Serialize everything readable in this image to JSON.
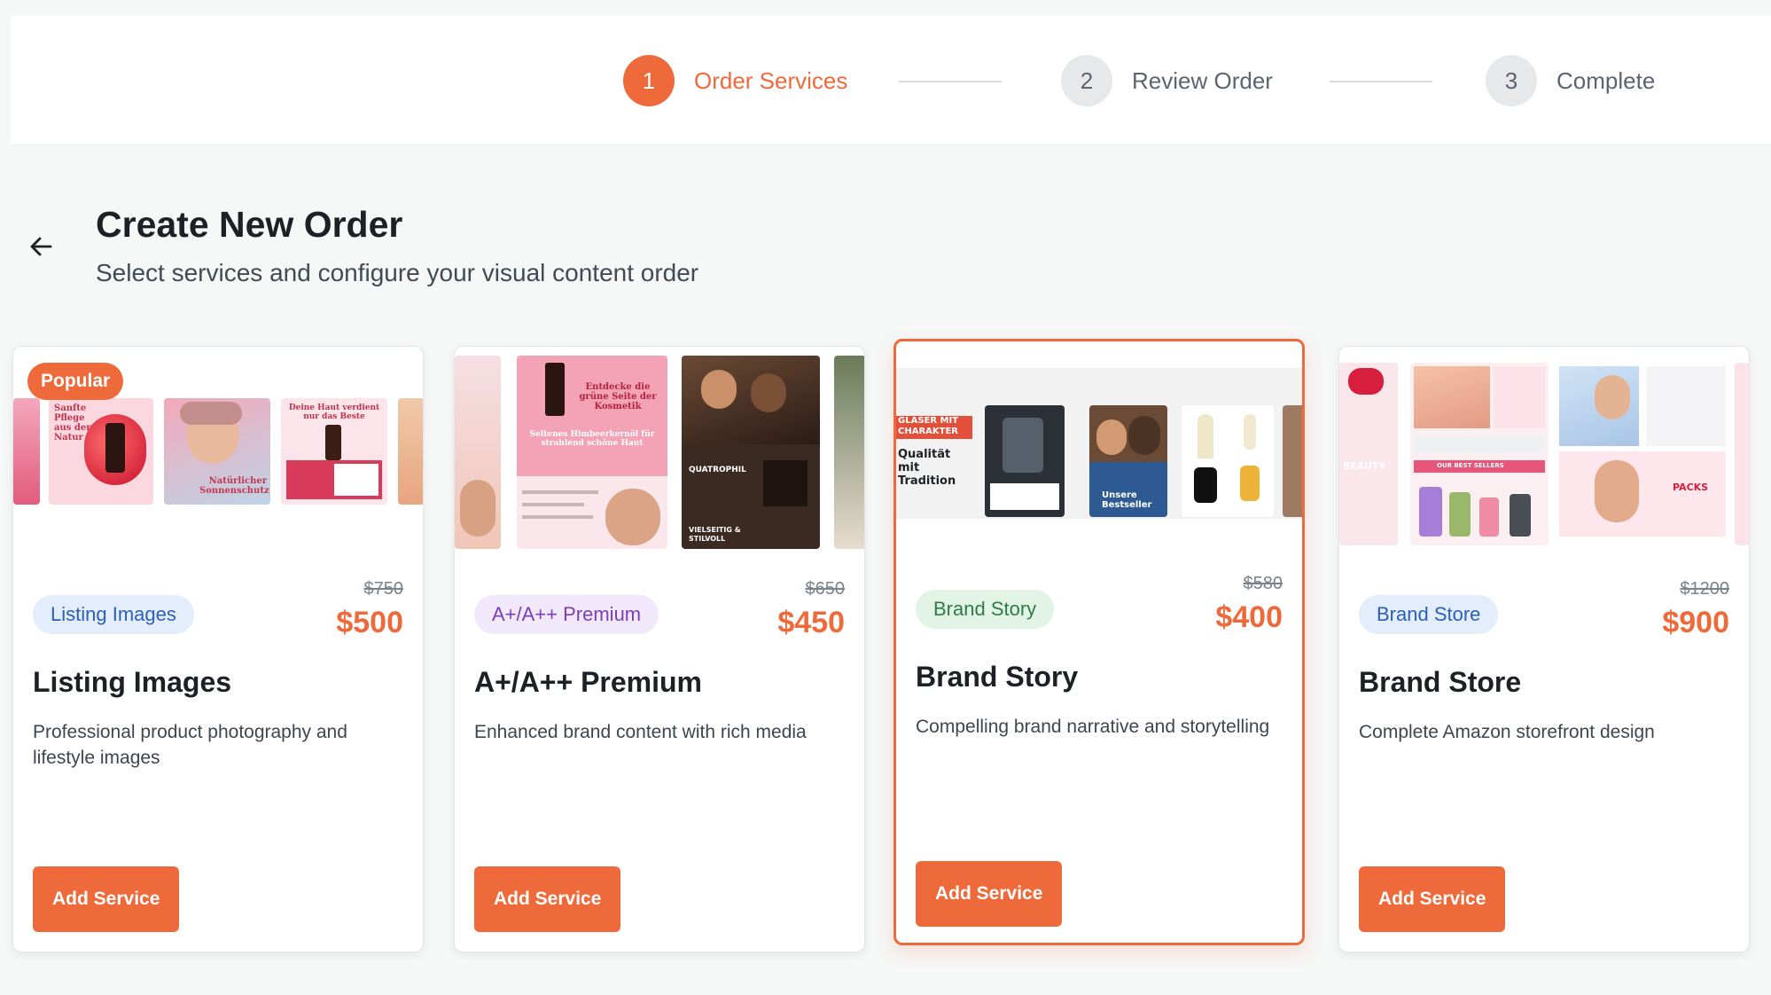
{
  "stepper": {
    "steps": [
      {
        "number": "1",
        "label": "Order Services",
        "state": "active"
      },
      {
        "number": "2",
        "label": "Review Order",
        "state": "inactive"
      },
      {
        "number": "3",
        "label": "Complete",
        "state": "inactive"
      }
    ]
  },
  "header": {
    "back_icon": "arrow-left-icon",
    "title": "Create New Order",
    "subtitle": "Select services and configure your visual content order"
  },
  "cards": [
    {
      "badge": "Listing Images",
      "popular": "Popular",
      "old_price": "$750",
      "price": "$500",
      "title": "Listing Images",
      "description": "Professional product photography and lifestyle images",
      "button": "Add Service",
      "thumb_text": [
        "Sanfte Pflege aus der Natur",
        "Natürlicher Sonnenschutz",
        "Deine Haut verdient nur das Beste"
      ]
    },
    {
      "badge": "A+/A++ Premium",
      "old_price": "$650",
      "price": "$450",
      "title": "A+/A++ Premium",
      "description": "Enhanced brand content with rich media",
      "button": "Add Service",
      "thumb_text": [
        "Entdecke die grüne Seite der Kosmetik",
        "Seltenes Himbeerkernöl für strahlend schöne Haut",
        "QUATROPHIL",
        "VIELSEITIG & STILVOLL"
      ]
    },
    {
      "badge": "Brand Story",
      "old_price": "$580",
      "price": "$400",
      "title": "Brand Story",
      "description": "Compelling brand narrative and storytelling",
      "button": "Add Service",
      "selected": true,
      "thumb_text": [
        "GLÄSER MIT CHARAKTER",
        "Qualität mit Tradition",
        "Unsere Bestseller"
      ]
    },
    {
      "badge": "Brand Store",
      "old_price": "$1200",
      "price": "$900",
      "title": "Brand Store",
      "description": "Complete Amazon storefront design",
      "button": "Add Service",
      "thumb_text": [
        "BEAUTY",
        "OUR BEST SELLERS",
        "PACKS"
      ]
    }
  ],
  "colors": {
    "accent": "#ef6a3a",
    "badge_listing_bg": "#e3edfb",
    "badge_listing_fg": "#2b5fb8",
    "badge_aplus_bg": "#f1e8fb",
    "badge_aplus_fg": "#7a3fb8",
    "badge_story_bg": "#e2f4e6",
    "badge_story_fg": "#2f7d45",
    "badge_store_bg": "#e3edfb",
    "badge_store_fg": "#2b5fb8"
  }
}
